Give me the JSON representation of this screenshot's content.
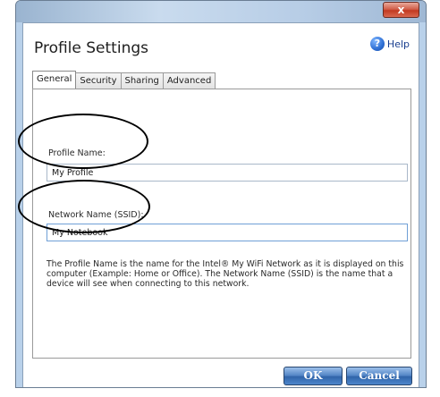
{
  "window": {
    "close_label": "x"
  },
  "header": {
    "title": "Profile Settings",
    "help_label": "Help",
    "help_icon": "?"
  },
  "tabs": [
    {
      "label": "General",
      "active": true
    },
    {
      "label": "Security",
      "active": false
    },
    {
      "label": "Sharing",
      "active": false
    },
    {
      "label": "Advanced",
      "active": false
    }
  ],
  "general": {
    "profile_name_label": "Profile Name:",
    "profile_name_value": "My Profile",
    "network_name_label": "Network Name (SSID):",
    "network_name_value": "My Notebook",
    "description": "The Profile Name is the name for the Intel® My WiFi Network as it is displayed on this computer (Example: Home or Office).  The Network Name (SSID) is the name that a device will see when connecting to this network."
  },
  "buttons": {
    "ok_label": "OK",
    "cancel_label": "Cancel"
  },
  "colors": {
    "accent_blue": "#4f82c4",
    "close_red": "#c23a22",
    "frame": "#b9d1ea"
  }
}
